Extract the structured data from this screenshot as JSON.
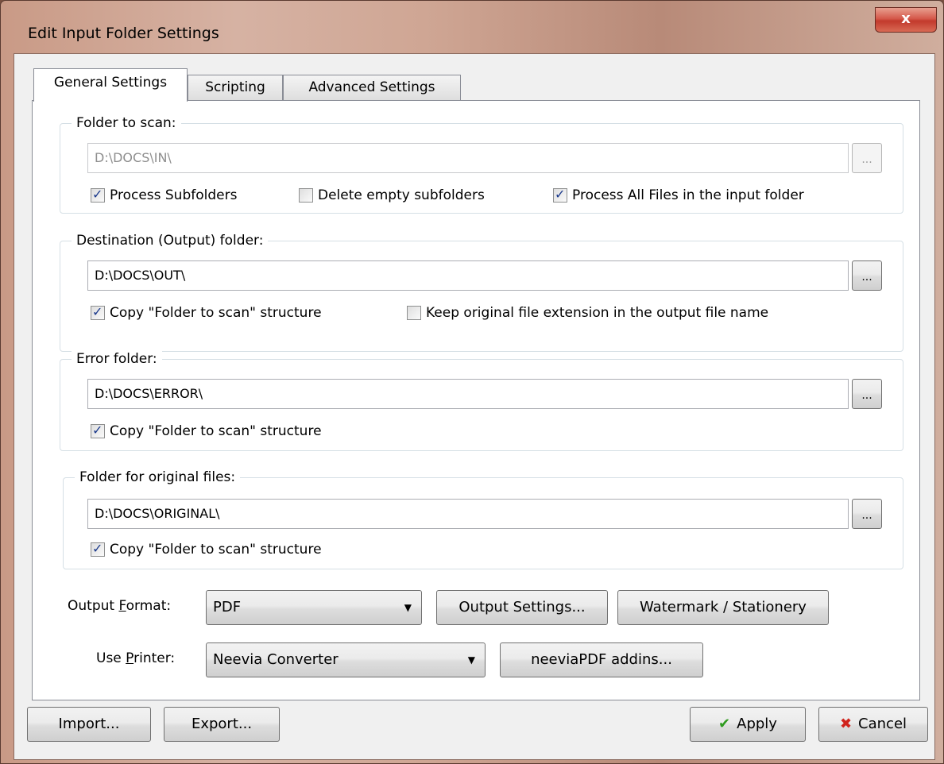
{
  "window": {
    "title": "Edit Input Folder Settings",
    "close_label": "x"
  },
  "tabs": [
    {
      "label": "General Settings",
      "active": true
    },
    {
      "label": "Scripting",
      "active": false
    },
    {
      "label": "Advanced Settings",
      "active": false
    }
  ],
  "scan": {
    "legend": "Folder to scan:",
    "path": "D:\\DOCS\\IN\\",
    "browse": "...",
    "process_subfolders": {
      "label": "Process Subfolders",
      "checked": true
    },
    "delete_empty": {
      "label": "Delete empty subfolders",
      "checked": false
    },
    "process_all": {
      "label": "Process All Files in the input folder",
      "checked": true
    }
  },
  "dest": {
    "legend": "Destination (Output) folder:",
    "path": "D:\\DOCS\\OUT\\",
    "browse": "...",
    "copy_structure": {
      "label": "Copy \"Folder to scan\" structure",
      "checked": true
    },
    "keep_ext": {
      "label": "Keep original file extension in the output file name",
      "checked": false
    }
  },
  "error": {
    "legend": "Error folder:",
    "path": "D:\\DOCS\\ERROR\\",
    "browse": "...",
    "copy_structure": {
      "label": "Copy \"Folder to scan\" structure",
      "checked": true
    }
  },
  "original": {
    "legend": "Folder for original files:",
    "path": "D:\\DOCS\\ORIGINAL\\",
    "browse": "...",
    "copy_structure": {
      "label": "Copy \"Folder to scan\" structure",
      "checked": true
    }
  },
  "output": {
    "format_label_pre": "Output ",
    "format_label_key": "F",
    "format_label_post": "ormat:",
    "format_value": "PDF",
    "settings_button": "Output Settings...",
    "watermark_button": "Watermark / Stationery"
  },
  "printer": {
    "label_pre": "Use ",
    "label_key": "P",
    "label_post": "rinter:",
    "value": "Neevia Converter",
    "addins_button": "neeviaPDF addins..."
  },
  "footer": {
    "import": "Import...",
    "export": "Export...",
    "apply": "Apply",
    "cancel": "Cancel",
    "apply_icon": "checkmark-icon",
    "cancel_icon": "x-icon"
  }
}
